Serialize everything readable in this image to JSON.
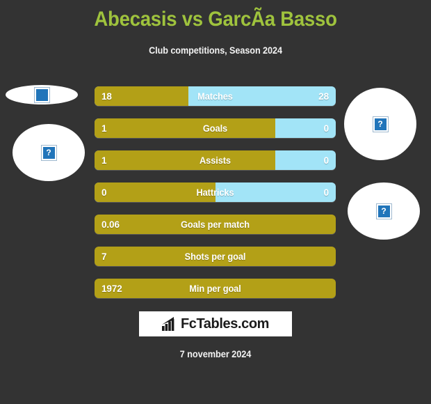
{
  "header": {
    "title": "Abecasis vs GarcÃ­a Basso",
    "subtitle": "Club competitions, Season 2024"
  },
  "colors": {
    "background": "#333333",
    "title_green": "#9fc33d",
    "home_gold": "#b3a017",
    "away_blue": "#a2e4f7",
    "text_white": "#ffffff",
    "logo_background": "#ffffff",
    "placeholder_blue": "#2175ba"
  },
  "avatars": {
    "home_top": {
      "icon": "broken-image-placeholder-icon",
      "glyph": ""
    },
    "home_main": {
      "icon": "broken-image-placeholder-icon",
      "glyph": "?"
    },
    "away_main": {
      "icon": "broken-image-placeholder-icon",
      "glyph": "?"
    },
    "away_bottom": {
      "icon": "broken-image-placeholder-icon",
      "glyph": "?"
    }
  },
  "stats": [
    {
      "label": "Matches",
      "home": "18",
      "away": "28",
      "home_pct": 39,
      "two_sided": true
    },
    {
      "label": "Goals",
      "home": "1",
      "away": "0",
      "home_pct": 75,
      "two_sided": true
    },
    {
      "label": "Assists",
      "home": "1",
      "away": "0",
      "home_pct": 75,
      "two_sided": true
    },
    {
      "label": "Hattricks",
      "home": "0",
      "away": "0",
      "home_pct": 50,
      "two_sided": true
    },
    {
      "label": "Goals per match",
      "home": "0.06",
      "away": "",
      "home_pct": 100,
      "two_sided": false
    },
    {
      "label": "Shots per goal",
      "home": "7",
      "away": "",
      "home_pct": 100,
      "two_sided": false
    },
    {
      "label": "Min per goal",
      "home": "1972",
      "away": "",
      "home_pct": 100,
      "two_sided": false
    }
  ],
  "logo": {
    "text": "FcTables.com",
    "icon": "bar-chart-arrow-icon"
  },
  "footer": {
    "date": "7 november 2024"
  },
  "chart_data": {
    "type": "bar",
    "title": "Abecasis vs GarcÃ­a Basso",
    "subtitle": "Club competitions, Season 2024",
    "categories": [
      "Matches",
      "Goals",
      "Assists",
      "Hattricks",
      "Goals per match",
      "Shots per goal",
      "Min per goal"
    ],
    "series": [
      {
        "name": "Abecasis",
        "values": [
          18,
          1,
          1,
          0,
          0.06,
          7,
          1972
        ]
      },
      {
        "name": "GarcÃ­a Basso",
        "values": [
          28,
          0,
          0,
          0,
          null,
          null,
          null
        ]
      }
    ],
    "orientation": "horizontal",
    "stacked": true,
    "legend": "none",
    "grid": false,
    "xlabel": "",
    "ylabel": ""
  }
}
